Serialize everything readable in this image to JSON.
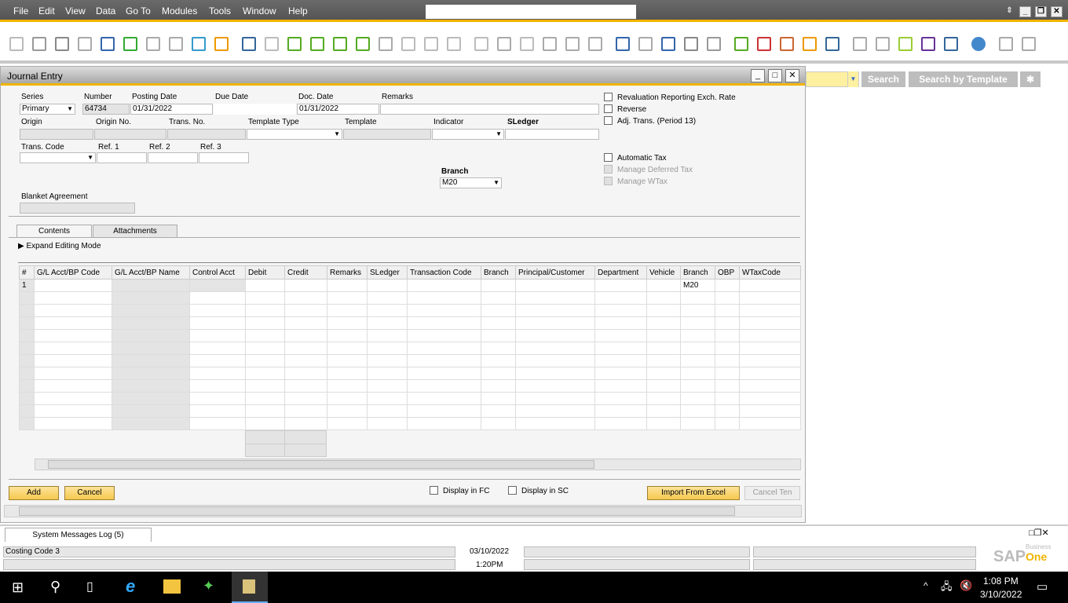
{
  "menu": [
    "File",
    "Edit",
    "View",
    "Data",
    "Go To",
    "Modules",
    "Tools",
    "Window",
    "Help"
  ],
  "toolbar_icons": [
    "print-preview-icon",
    "print-icon",
    "email-icon",
    "sms-icon",
    "fax-icon",
    "excel-icon",
    "word-icon",
    "pdf-icon",
    "launch-app-icon",
    "lock-screen-icon",
    "find-icon",
    "add-icon",
    "first-record-icon",
    "previous-record-icon",
    "next-record-icon",
    "last-record-icon",
    "refresh-icon",
    "filter-icon",
    "sort-icon",
    "base-document-icon",
    "target-document-icon",
    "gross-profit-icon",
    "payment-means-icon",
    "volume-weight-icon",
    "exchange-rates-icon",
    "settings-icon",
    "edit-icon",
    "document-icon",
    "approve-icon",
    "messages-icon",
    "alerts-icon",
    "calendar-icon",
    "mail-icon",
    "reports-icon",
    "org-chart-icon",
    "user-icon",
    "dashboard-icon",
    "copy-icon",
    "growth-icon",
    "analytics-icon",
    "web-icon",
    "help-icon",
    "form-settings-icon",
    "layout-icon"
  ],
  "search": {
    "search_label": "Search",
    "template_label": "Search by Template",
    "star_label": "✱"
  },
  "window": {
    "title": "Journal Entry"
  },
  "form": {
    "series_label": "Series",
    "series_value": "Primary",
    "number_label": "Number",
    "number_value": "64734",
    "posting_date_label": "Posting Date",
    "posting_date_value": "01/31/2022",
    "due_date_label": "Due Date",
    "due_date_value": "",
    "doc_date_label": "Doc. Date",
    "doc_date_value": "01/31/2022",
    "remarks_label": "Remarks",
    "remarks_value": "",
    "origin_label": "Origin",
    "origin_no_label": "Origin No.",
    "trans_no_label": "Trans. No.",
    "template_type_label": "Template Type",
    "template_label": "Template",
    "indicator_label": "Indicator",
    "sledger_label": "SLedger",
    "trans_code_label": "Trans. Code",
    "ref1_label": "Ref. 1",
    "ref2_label": "Ref. 2",
    "ref3_label": "Ref. 3",
    "branch_label": "Branch",
    "branch_value": "M20",
    "blanket_label": "Blanket Agreement",
    "checks": {
      "revaluation": "Revaluation Reporting Exch. Rate",
      "reverse": "Reverse",
      "adj_trans": "Adj. Trans. (Period 13)",
      "automatic_tax": "Automatic Tax",
      "deferred_tax": "Manage Deferred Tax",
      "wtax": "Manage WTax"
    }
  },
  "tabs": [
    "Contents",
    "Attachments"
  ],
  "expand_label": "Expand Editing Mode",
  "grid": {
    "columns": [
      "#",
      "G/L Acct/BP Code",
      "G/L Acct/BP Name",
      "Control Acct",
      "Debit",
      "Credit",
      "Remarks",
      "SLedger",
      "Transaction Code",
      "Branch",
      "Principal/Customer",
      "Department",
      "Vehicle",
      "Branch",
      "OBP",
      "WTaxCode"
    ],
    "first_row": {
      "num": "1",
      "branch": "M20"
    }
  },
  "buttons": {
    "add": "Add",
    "cancel": "Cancel",
    "display_fc": "Display in FC",
    "display_sc": "Display in SC",
    "import_excel": "Import From Excel",
    "cancel_template": "Cancel Ten"
  },
  "messages_tab": "System Messages Log (5)",
  "status": {
    "message": "Costing Code 3",
    "date": "03/10/2022",
    "time": "1:20PM",
    "logo_sap": "SAP",
    "logo_business": "Business",
    "logo_one": "One"
  },
  "taskbar": {
    "time": "1:08 PM",
    "date": "3/10/2022"
  },
  "colors": {
    "accent": "#f0b400",
    "button": "#f5c94f"
  }
}
